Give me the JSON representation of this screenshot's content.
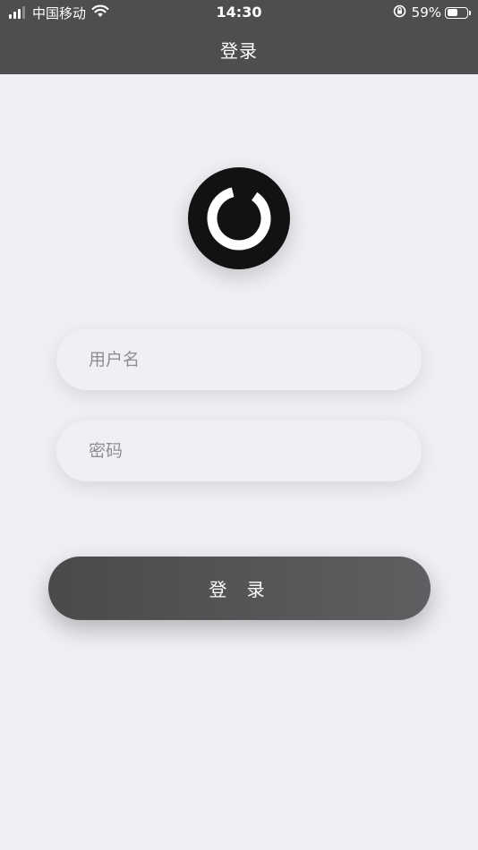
{
  "status_bar": {
    "carrier": "中国移动",
    "time": "14:30",
    "battery_percent": "59%",
    "battery_level": 0.59,
    "icons": [
      "signal-icon",
      "wifi-icon",
      "orientation-lock-icon",
      "battery-icon"
    ]
  },
  "nav": {
    "title": "登录"
  },
  "logo": {
    "icon": "app-logo-icon"
  },
  "form": {
    "username_placeholder": "用户名",
    "username_value": "",
    "password_placeholder": "密码",
    "password_value": "",
    "submit_label": "登 录"
  },
  "colors": {
    "nav_background": "#4e4e4e",
    "page_background": "#efeff4",
    "button_gradient_start": "#4a4a4a",
    "button_gradient_end": "#5f5f62"
  }
}
